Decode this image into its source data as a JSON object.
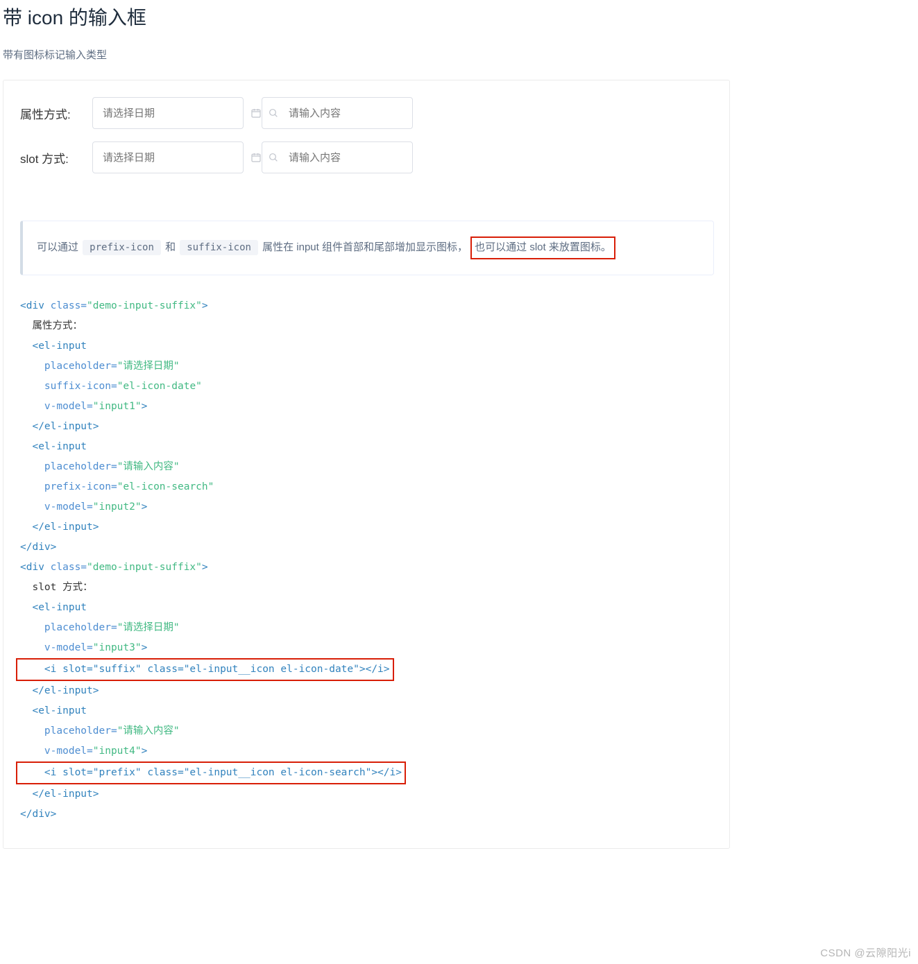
{
  "heading": "带 icon 的输入框",
  "subheading": "带有图标标记输入类型",
  "demo": {
    "row1_label": "属性方式:",
    "row2_label": "slot 方式:",
    "date_placeholder": "请选择日期",
    "search_placeholder": "请输入内容"
  },
  "note": {
    "part1": "可以通过 ",
    "code1": "prefix-icon",
    "part2": " 和 ",
    "code2": "suffix-icon",
    "part3": " 属性在 input 组件首部和尾部增加显示图标，",
    "highlighted": "也可以通过 slot 来放置图标。"
  },
  "code": {
    "l1_open": "<div",
    "l1_attr": " class=",
    "l1_val": "\"demo-input-suffix\"",
    "l1_close": ">",
    "l2": "  属性方式：",
    "l3": "  <el-input",
    "l4a": "    placeholder=",
    "l4v": "\"请选择日期\"",
    "l5a": "    suffix-icon=",
    "l5v": "\"el-icon-date\"",
    "l6a": "    v-model=",
    "l6v": "\"input1\"",
    "l6c": ">",
    "l7": "  </el-input>",
    "l8": "  <el-input",
    "l9a": "    placeholder=",
    "l9v": "\"请输入内容\"",
    "l10a": "    prefix-icon=",
    "l10v": "\"el-icon-search\"",
    "l11a": "    v-model=",
    "l11v": "\"input2\"",
    "l11c": ">",
    "l12": "  </el-input>",
    "l13": "</div>",
    "l14_open": "<div",
    "l14_attr": " class=",
    "l14_val": "\"demo-input-suffix\"",
    "l14_close": ">",
    "l15": "  slot 方式：",
    "l16": "  <el-input",
    "l17a": "    placeholder=",
    "l17v": "\"请选择日期\"",
    "l18a": "    v-model=",
    "l18v": "\"input3\"",
    "l18c": ">",
    "l19": "    <i slot=\"suffix\" class=\"el-input__icon el-icon-date\"></i>",
    "l20": "  </el-input>",
    "l21": "  <el-input",
    "l22a": "    placeholder=",
    "l22v": "\"请输入内容\"",
    "l23a": "    v-model=",
    "l23v": "\"input4\"",
    "l23c": ">",
    "l24": "    <i slot=\"prefix\" class=\"el-input__icon el-icon-search\"></i>",
    "l25": "  </el-input>",
    "l26": "</div>"
  },
  "watermark": "CSDN @云隙阳光i"
}
